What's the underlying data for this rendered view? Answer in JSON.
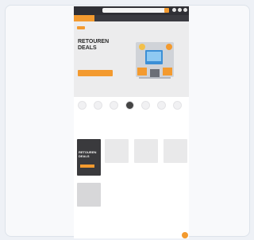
{
  "header": {
    "logo": "",
    "search_placeholder": ""
  },
  "categories": {
    "all": "",
    "items": []
  },
  "hero": {
    "tag": "",
    "title": "RETOUREN DEALS",
    "subtitle": "",
    "cta": "",
    "bullets": []
  },
  "category_icons": [],
  "section": {
    "title": "",
    "link": ""
  },
  "products": [],
  "promo": {
    "title": "RETOUREN DEALS"
  },
  "bottom_section": {
    "title": ""
  }
}
